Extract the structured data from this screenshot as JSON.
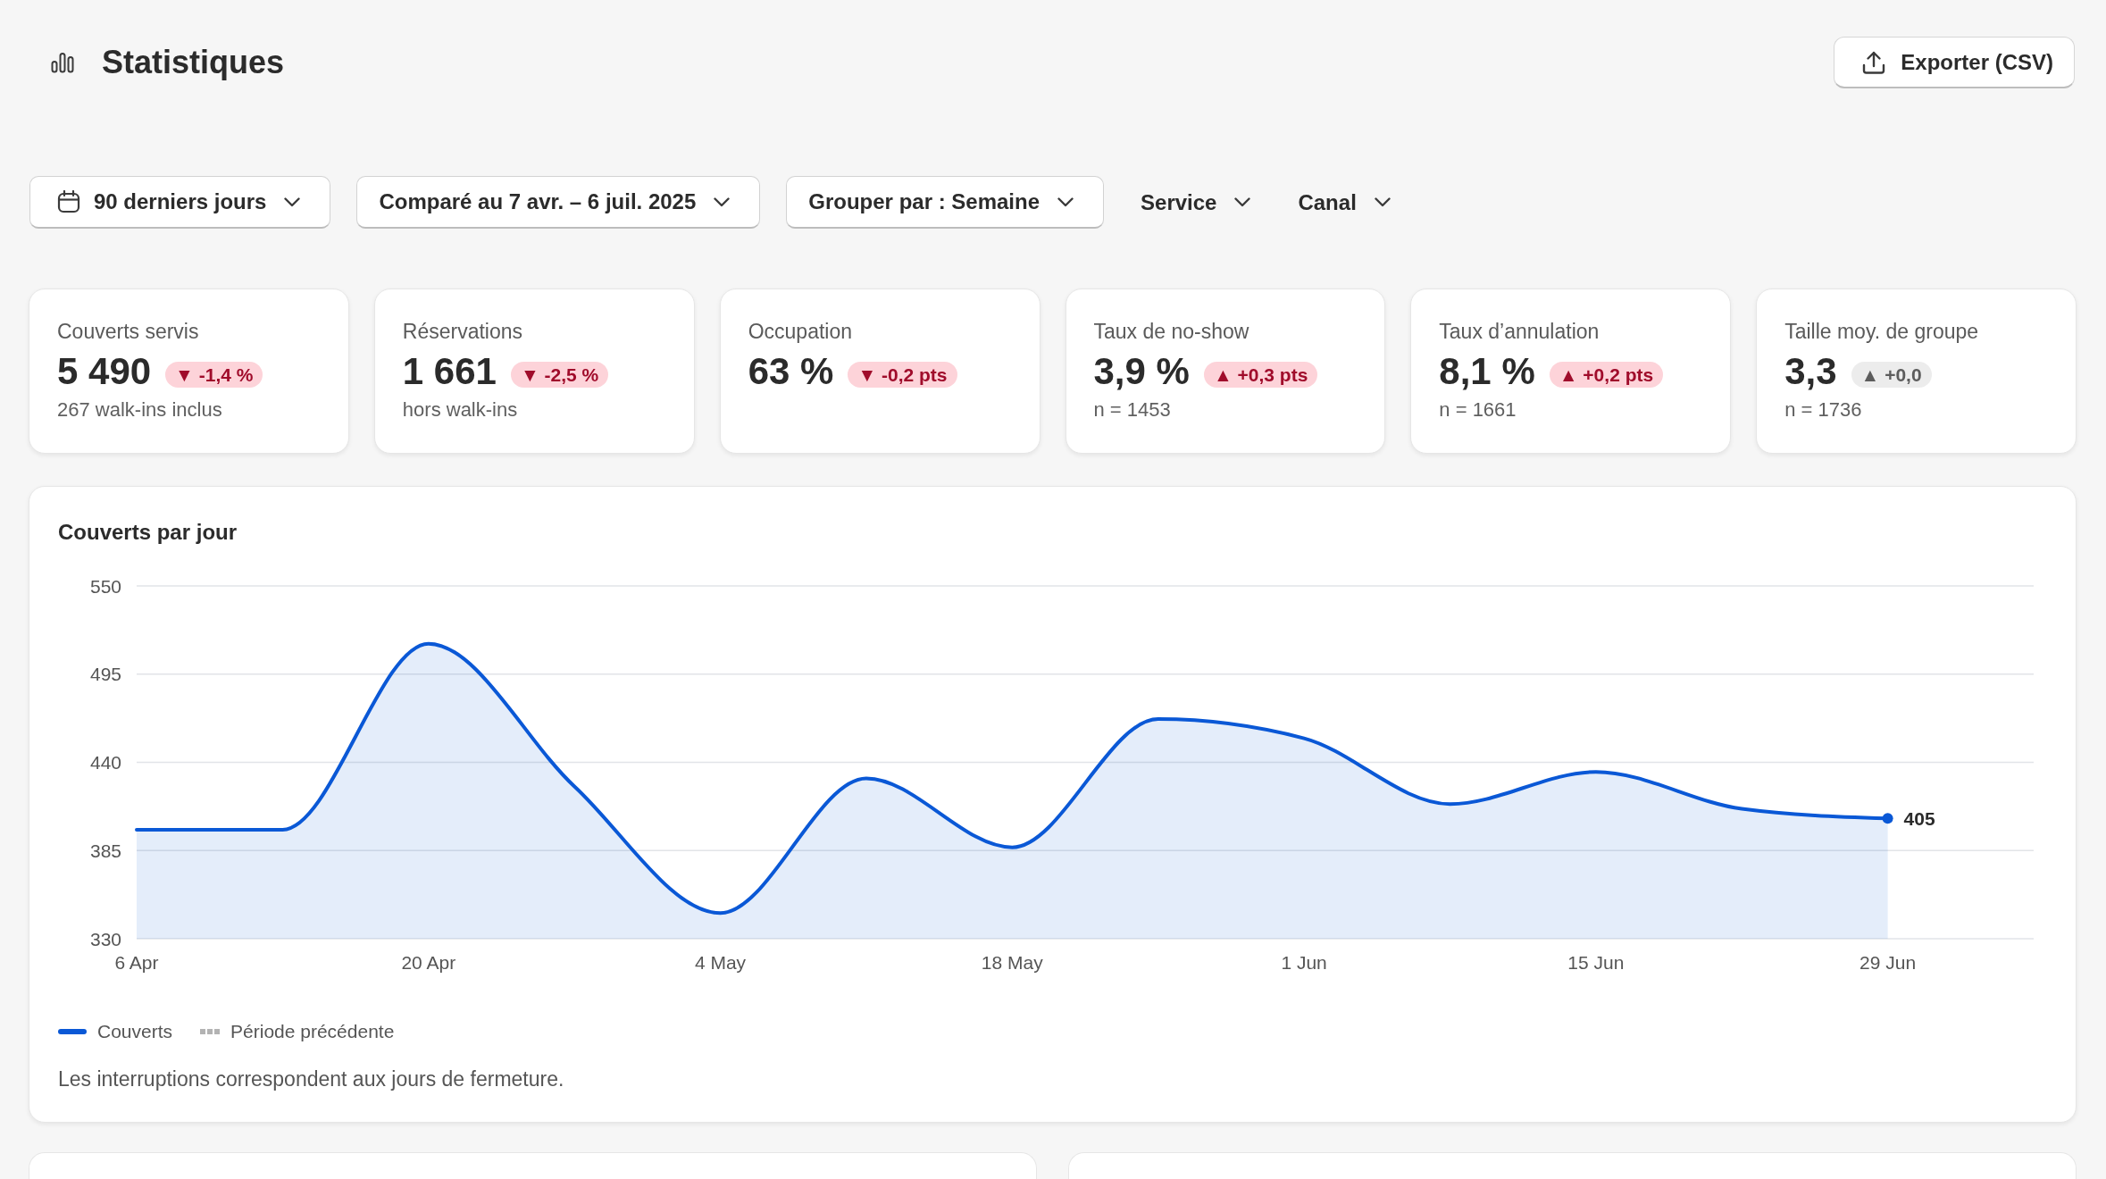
{
  "header": {
    "title": "Statistiques",
    "export_button": "Exporter (CSV)"
  },
  "filters": [
    {
      "kind": "date",
      "label": "90 derniers jours"
    },
    {
      "kind": "boxed",
      "label": "Comparé au 7 avr. – 6 juil. 2025"
    },
    {
      "kind": "boxed",
      "label": "Grouper par : Semaine"
    },
    {
      "kind": "plain",
      "label": "Service"
    },
    {
      "kind": "plain",
      "label": "Canal"
    }
  ],
  "kpis": [
    {
      "label": "Couverts servis",
      "value": "5 490",
      "change": {
        "text": "▼ -1,4 %",
        "unfavorable": true
      },
      "note": "267 walk-ins inclus"
    },
    {
      "label": "Réservations",
      "value": "1 661",
      "change": {
        "text": "▼ -2,5 %",
        "unfavorable": true
      },
      "note": "hors walk-ins"
    },
    {
      "label": "Occupation",
      "value": "63 %",
      "change": {
        "text": "▼ -0,2 pts",
        "unfavorable": true
      }
    },
    {
      "label": "Taux de no-show",
      "value": "3,9 %",
      "change": {
        "text": "▲ +0,3 pts",
        "unfavorable": true
      },
      "note": "n = 1453"
    },
    {
      "label": "Taux d’annulation",
      "value": "8,1 %",
      "change": {
        "text": "▲ +0,2 pts",
        "unfavorable": true
      },
      "note": "n = 1661"
    },
    {
      "label": "Taille moy. de groupe",
      "value": "3,3",
      "change": {
        "text": "▲ +0,0",
        "unfavorable": false
      },
      "note": "n = 1736"
    }
  ],
  "chart": {
    "title": "Couverts par jour",
    "chart_data": {
      "type": "area",
      "categories": [
        "6 Apr",
        null,
        "20 Apr",
        null,
        "4 May",
        null,
        "18 May",
        null,
        "1 Jun",
        null,
        "15 Jun",
        null,
        "29 Jun"
      ],
      "ylim": [
        330,
        550
      ],
      "yticks": [
        330,
        385,
        440,
        495,
        550
      ],
      "grid": true,
      "series": [
        {
          "name": "Couverts",
          "color": "#0a58d6",
          "values": [
            398,
            398,
            514,
            425,
            346,
            430,
            387,
            467,
            455,
            414,
            434,
            411,
            405
          ]
        }
      ],
      "annotations": [
        "405"
      ]
    },
    "comparison_legend": {
      "kind": "dotted",
      "label": "Période précédente",
      "color": "#b3b3b3"
    },
    "note": "Les interruptions correspondent aux jours de fermeture."
  }
}
